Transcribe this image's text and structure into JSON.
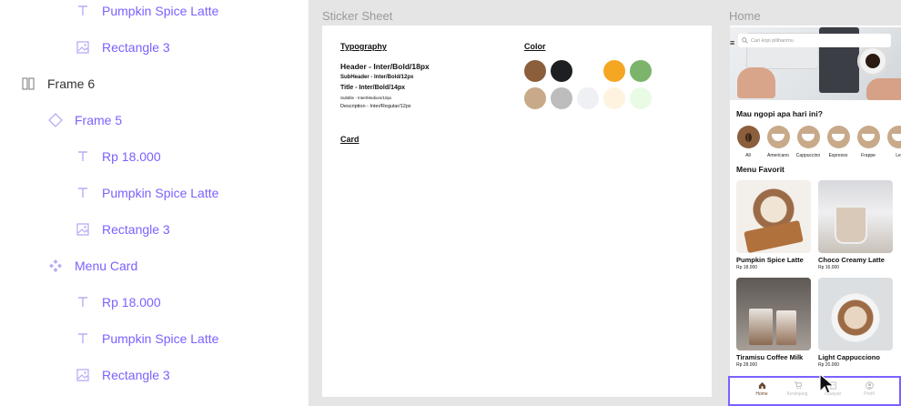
{
  "layers": [
    {
      "label": "Pumpkin Spice Latte",
      "icon": "text-icon"
    },
    {
      "label": "Rectangle 3",
      "icon": "image-icon"
    },
    {
      "label": "Frame 6",
      "icon": "frame-columns-icon"
    },
    {
      "label": "Frame 5",
      "icon": "diamond-icon"
    },
    {
      "label": "Rp 18.000",
      "icon": "text-icon"
    },
    {
      "label": "Pumpkin Spice Latte",
      "icon": "text-icon"
    },
    {
      "label": "Rectangle 3",
      "icon": "image-icon"
    },
    {
      "label": "Menu Card",
      "icon": "component-icon"
    },
    {
      "label": "Rp 18.000",
      "icon": "text-icon"
    },
    {
      "label": "Pumpkin Spice Latte",
      "icon": "text-icon"
    },
    {
      "label": "Rectangle 3",
      "icon": "image-icon"
    }
  ],
  "frames": {
    "sticker_sheet": "Sticker Sheet",
    "home": "Home"
  },
  "sheet": {
    "typography_title": "Typography",
    "header": "Header - Inter/Bold/18px",
    "subheader": "SubHeader - Inter/Bold/12px",
    "title": "Title - Inter/Bold/14px",
    "subtitle": "Subtitle - Inter/Medium/10px",
    "description": "Description - Inter/Regular/12px",
    "color_title": "Color",
    "card_title": "Card",
    "colors": [
      "#8b5e3c",
      "#1e1f23",
      "#ffffff",
      "#f5a623",
      "#7cb46b",
      "#c8a98a",
      "#bdbdbd",
      "#eef0f3",
      "#fdf3df",
      "#eafbe5"
    ]
  },
  "home": {
    "search_placeholder": "Cari kopi pilihanmu",
    "question": "Mau ngopi apa hari ini?",
    "categories": [
      "All",
      "Americano",
      "Cappuccino",
      "Espresso",
      "Frappe",
      "Le"
    ],
    "favorites_title": "Menu Favorit",
    "products": [
      {
        "name": "Pumpkin Spice Latte",
        "price": "Rp 18.000"
      },
      {
        "name": "Choco Creamy Latte",
        "price": "Rp 16.000"
      },
      {
        "name": "Tiramisu Coffee Milk",
        "price": "Rp 28.000"
      },
      {
        "name": "Light Cappucciono",
        "price": "Rp 20.000"
      }
    ],
    "nav": [
      "Home",
      "Keranjang",
      "Riwayat",
      "Profil"
    ]
  },
  "accent": "#7b61ff"
}
